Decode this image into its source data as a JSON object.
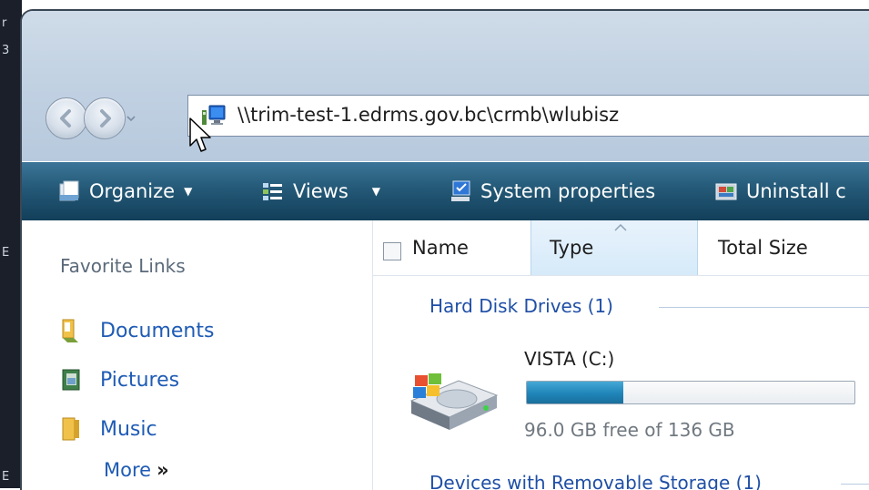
{
  "desktop": {
    "edge_chars": [
      "r",
      "3",
      "E",
      "E"
    ]
  },
  "address_bar": {
    "path": "\\\\trim-test-1.edrms.gov.bc\\crmb\\wlubisz"
  },
  "toolbar": {
    "organize": "Organize",
    "views": "Views",
    "system_properties": "System properties",
    "uninstall": "Uninstall c"
  },
  "favorites": {
    "title": "Favorite Links",
    "items": [
      {
        "label": "Documents",
        "icon": "documents-folder-icon"
      },
      {
        "label": "Pictures",
        "icon": "pictures-folder-icon"
      },
      {
        "label": "Music",
        "icon": "music-folder-icon"
      }
    ],
    "more_label": "More",
    "more_chevron": "»"
  },
  "columns": {
    "name": "Name",
    "type": "Type",
    "total_size": "Total Size"
  },
  "groups": {
    "hard_disks": "Hard Disk Drives (1)",
    "removable": "Devices with Removable Storage (1)"
  },
  "drive": {
    "name": "VISTA (C:)",
    "free_text": "96.0 GB free of 136 GB",
    "used_fraction": 0.294
  },
  "colors": {
    "toolbar": "#245977",
    "link": "#1f5bb5",
    "capacity_fill": "#1f84b8"
  }
}
